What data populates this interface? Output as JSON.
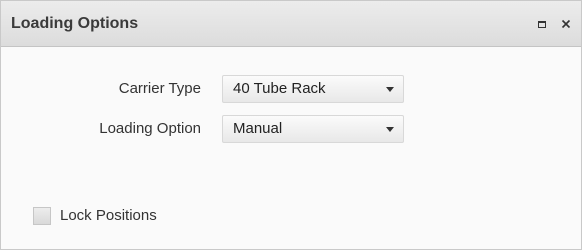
{
  "panel": {
    "title": "Loading Options",
    "maximize_icon": "maximize-icon",
    "close_icon": "close-icon",
    "close_glyph": "×"
  },
  "form": {
    "carrier_type": {
      "label": "Carrier Type",
      "value": "40 Tube Rack"
    },
    "loading_option": {
      "label": "Loading Option",
      "value": "Manual"
    }
  },
  "lock_positions": {
    "label": "Lock Positions",
    "checked": false
  }
}
